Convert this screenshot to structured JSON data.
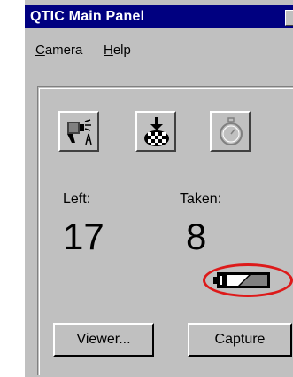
{
  "window": {
    "title": "QTIC  Main Panel"
  },
  "menu": {
    "camera": {
      "accel": "C",
      "rest": "amera"
    },
    "help": {
      "accel": "H",
      "rest": "elp"
    }
  },
  "toolbar": {
    "items": [
      {
        "icon": "camera-tripod-icon"
      },
      {
        "icon": "download-checker-icon"
      },
      {
        "icon": "stopwatch-icon",
        "enabled": false
      }
    ]
  },
  "status": {
    "left_label": "Left:",
    "left_value": "17",
    "taken_label": "Taken:",
    "taken_value": "8",
    "battery_icon": "battery-icon",
    "highlight_color": "#dd1a1a"
  },
  "buttons": {
    "viewer": "Viewer...",
    "capture": "Capture"
  }
}
